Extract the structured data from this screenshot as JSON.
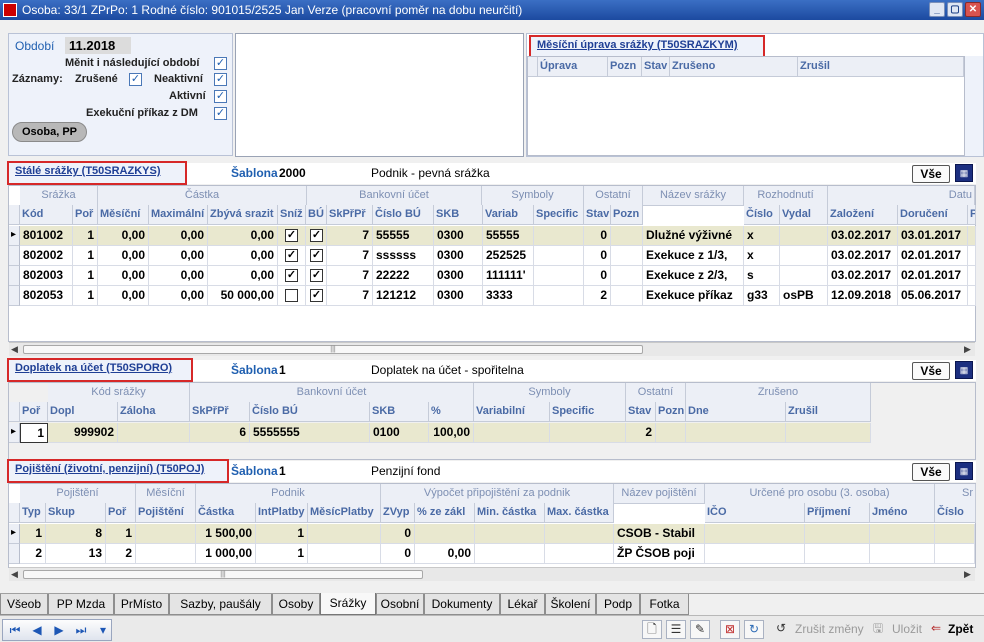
{
  "window": {
    "title": "Osoba: 33/1   ZPrPo: 1   Rodné číslo: 901015/2525   Jan Verze   (pracovní poměr na dobu neurčití)"
  },
  "filters": {
    "obdobi_label": "Období",
    "obdobi_value": "11.2018",
    "menit": "Měnit i následující období",
    "zaznamy": "Záznamy:",
    "zrusene": "Zrušené",
    "neaktivni": "Neaktivní",
    "aktivni": "Aktivní",
    "exekucni": "Exekuční příkaz z DM",
    "osoba_button": "Osoba, PP"
  },
  "mesicni": {
    "title": "Měsíční úprava srážky   (T50SRAZKYM)",
    "columns": [
      "Úprava",
      "Pozn",
      "Stav",
      "Zrušeno",
      "Zrušil"
    ]
  },
  "stale": {
    "title": "Stálé srážky   (T50SRAZKYS)",
    "sablona_label": "Šablona",
    "sablona_value": "2000",
    "sablona_desc": "Podnik - pevná srážka",
    "vse": "Vše",
    "group_headers": [
      "Srážka",
      "Částka",
      "Bankovní účet",
      "Symboly",
      "Ostatní",
      "Název srážky",
      "Rozhodnutí",
      "Datu"
    ],
    "columns": [
      "Kód",
      "Poř",
      "Měsíční",
      "Maximální",
      "Zbývá srazit",
      "Sníž",
      "BÚ",
      "SkPřPř",
      "Číslo BÚ",
      "SKB",
      "Variab",
      "Specific",
      "Stav",
      "Pozn",
      "",
      "Číslo",
      "Vydal",
      "Založení",
      "Doručení",
      "P"
    ],
    "rows": [
      {
        "kod": "801002",
        "por": "1",
        "mesicni": "0,00",
        "maximalni": "0,00",
        "zbyva": "0,00",
        "sniz": true,
        "bu": true,
        "skprpr": "7",
        "cislo_bu": "55555",
        "skb": "0300",
        "variab": "55555",
        "specific": "",
        "stav": "0",
        "pozn": "",
        "nazev": "Dlužné výživné",
        "cislo": "x",
        "vydal": "",
        "zalozeni": "03.02.2017",
        "doruceni": "03.01.2017"
      },
      {
        "kod": "802002",
        "por": "1",
        "mesicni": "0,00",
        "maximalni": "0,00",
        "zbyva": "0,00",
        "sniz": true,
        "bu": true,
        "skprpr": "7",
        "cislo_bu": "ssssss",
        "skb": "0300",
        "variab": "252525",
        "specific": "",
        "stav": "0",
        "pozn": "",
        "nazev": "Exekuce  z 1/3,",
        "cislo": "x",
        "vydal": "",
        "zalozeni": "03.02.2017",
        "doruceni": "02.01.2017"
      },
      {
        "kod": "802003",
        "por": "1",
        "mesicni": "0,00",
        "maximalni": "0,00",
        "zbyva": "0,00",
        "sniz": true,
        "bu": true,
        "skprpr": "7",
        "cislo_bu": "22222",
        "skb": "0300",
        "variab": "111111'",
        "specific": "",
        "stav": "0",
        "pozn": "",
        "nazev": "Exekuce  z 2/3,",
        "cislo": "s",
        "vydal": "",
        "zalozeni": "03.02.2017",
        "doruceni": "02.01.2017"
      },
      {
        "kod": "802053",
        "por": "1",
        "mesicni": "0,00",
        "maximalni": "0,00",
        "zbyva": "50 000,00",
        "sniz": false,
        "bu": true,
        "skprpr": "7",
        "cislo_bu": "121212",
        "skb": "0300",
        "variab": "3333",
        "specific": "",
        "stav": "2",
        "pozn": "",
        "nazev": "Exekuce příkaz",
        "cislo": "g33",
        "vydal": "osPB",
        "zalozeni": "12.09.2018",
        "doruceni": "05.06.2017"
      }
    ]
  },
  "doplatek": {
    "title": "Doplatek na účet   (T50SPORO)",
    "sablona_label": "Šablona",
    "sablona_value": "1",
    "sablona_desc": "Doplatek na účet - spořitelna",
    "vse": "Vše",
    "group_headers": [
      "Kód srážky",
      "Bankovní účet",
      "Symboly",
      "Ostatní",
      "Zrušeno"
    ],
    "columns": [
      "Poř",
      "Dopl",
      "Záloha",
      "SkPřPř",
      "Číslo BÚ",
      "SKB",
      "%",
      "Variabilní",
      "Specific",
      "Stav",
      "Pozn",
      "Dne",
      "Zrušil"
    ],
    "rows": [
      {
        "por": "1",
        "dopl": "999902",
        "zaloha": "",
        "skprpr": "6",
        "cislo_bu": "5555555",
        "skb": "0100",
        "pct": "100,00",
        "variab": "",
        "specific": "",
        "stav": "2",
        "pozn": "",
        "dne": "",
        "zrusil": ""
      }
    ]
  },
  "pojisteni": {
    "title": "Pojištění (životní, penzijní)   (T50POJ)",
    "sablona_label": "Šablona",
    "sablona_value": "1",
    "sablona_desc": "Penzijní fond",
    "vse": "Vše",
    "group_headers": [
      "Pojištění",
      "Měsíční",
      "Podnik",
      "Výpočet připojištění za podnik",
      "Název pojištění",
      "Určené pro osobu   (3. osoba)",
      "Sr"
    ],
    "columns": [
      "Typ",
      "Skup",
      "Poř",
      "Pojištění",
      "Částka",
      "IntPlatby",
      "MěsícPlatby",
      "ZVyp",
      "%  ze zákl",
      "Min. částka",
      "Max. částka",
      "",
      "IČO",
      "Příjmení",
      "Jméno",
      "Číslo"
    ],
    "rows": [
      {
        "typ": "1",
        "skup": "8",
        "por": "1",
        "pojisteni": "",
        "castka": "1 500,00",
        "intplatby": "1",
        "mesplatby": "",
        "zvyp": "0",
        "pct": "",
        "min": "",
        "max": "",
        "nazev": "CSOB - Stabil"
      },
      {
        "typ": "2",
        "skup": "13",
        "por": "2",
        "pojisteni": "",
        "castka": "1 000,00",
        "intplatby": "1",
        "mesplatby": "",
        "zvyp": "0",
        "pct": "0,00",
        "min": "",
        "max": "",
        "nazev": "ŽP ČSOB poji"
      }
    ]
  },
  "tabs": [
    "Všeob",
    "PP Mzda",
    "PrMísto",
    "Sazby, paušály",
    "Osoby",
    "Srážky",
    "Osobní",
    "Dokumenty",
    "Lékař",
    "Školení",
    "Podp",
    "Fotka"
  ],
  "active_tab": "Srážky",
  "toolbar": {
    "zrusit_zmeny": "Zrušit změny",
    "ulozit": "Uložit",
    "zpet": "Zpět"
  }
}
